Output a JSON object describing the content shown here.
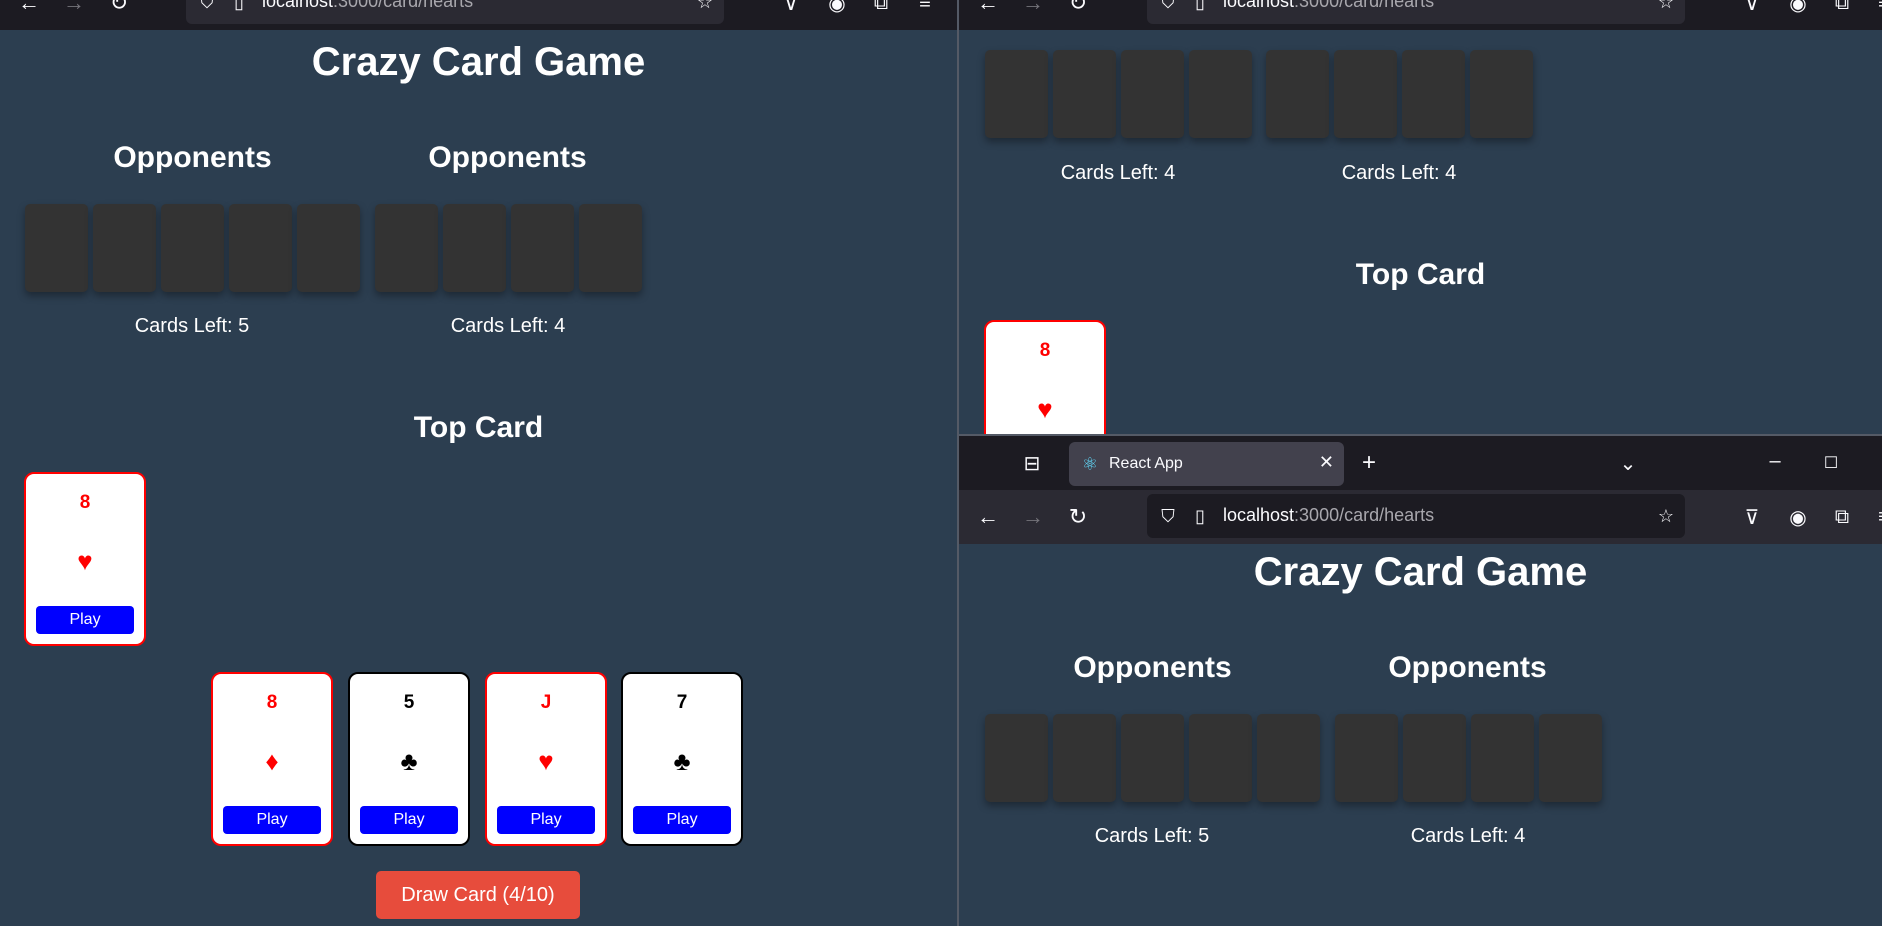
{
  "browser": {
    "url_host": "localhost",
    "url_rest": ":3000/card/hearts",
    "tab_title": "React App"
  },
  "game": {
    "title": "Crazy Card Game",
    "opponents_label": "Opponents",
    "opponents": [
      {
        "cards_left_label": "Cards Left: 5",
        "card_count": 5
      },
      {
        "cards_left_label": "Cards Left: 4",
        "card_count": 4
      }
    ],
    "top_card_label": "Top Card",
    "top_card": {
      "rank": "8",
      "suit": "♥",
      "color": "red",
      "play_label": "Play"
    },
    "hand": [
      {
        "rank": "8",
        "suit": "♦",
        "color": "red",
        "play_label": "Play"
      },
      {
        "rank": "5",
        "suit": "♣",
        "color": "black",
        "play_label": "Play"
      },
      {
        "rank": "J",
        "suit": "♥",
        "color": "red",
        "play_label": "Play"
      },
      {
        "rank": "7",
        "suit": "♣",
        "color": "black",
        "play_label": "Play"
      }
    ],
    "draw_button_label": "Draw Card (4/10)"
  },
  "top_right_pane": {
    "opponents": [
      {
        "cards_left_label": "Cards Left: 4",
        "card_count": 4
      },
      {
        "cards_left_label": "Cards Left: 4",
        "card_count": 4
      }
    ]
  },
  "colors": {
    "background": "#2c3e50",
    "play_button": "#0000ff",
    "draw_button": "#e74c3c",
    "card_back": "#333333",
    "red_suit": "#ff0000"
  },
  "icons": [
    "back-arrow-icon",
    "forward-arrow-icon",
    "reload-icon",
    "shield-icon",
    "page-icon",
    "bookmark-star-icon",
    "pocket-icon",
    "account-icon",
    "extensions-icon",
    "menu-icon",
    "tab-overview-icon",
    "react-favicon-icon",
    "close-tab-icon",
    "new-tab-icon",
    "tab-list-icon",
    "minimize-icon",
    "maximize-icon"
  ]
}
